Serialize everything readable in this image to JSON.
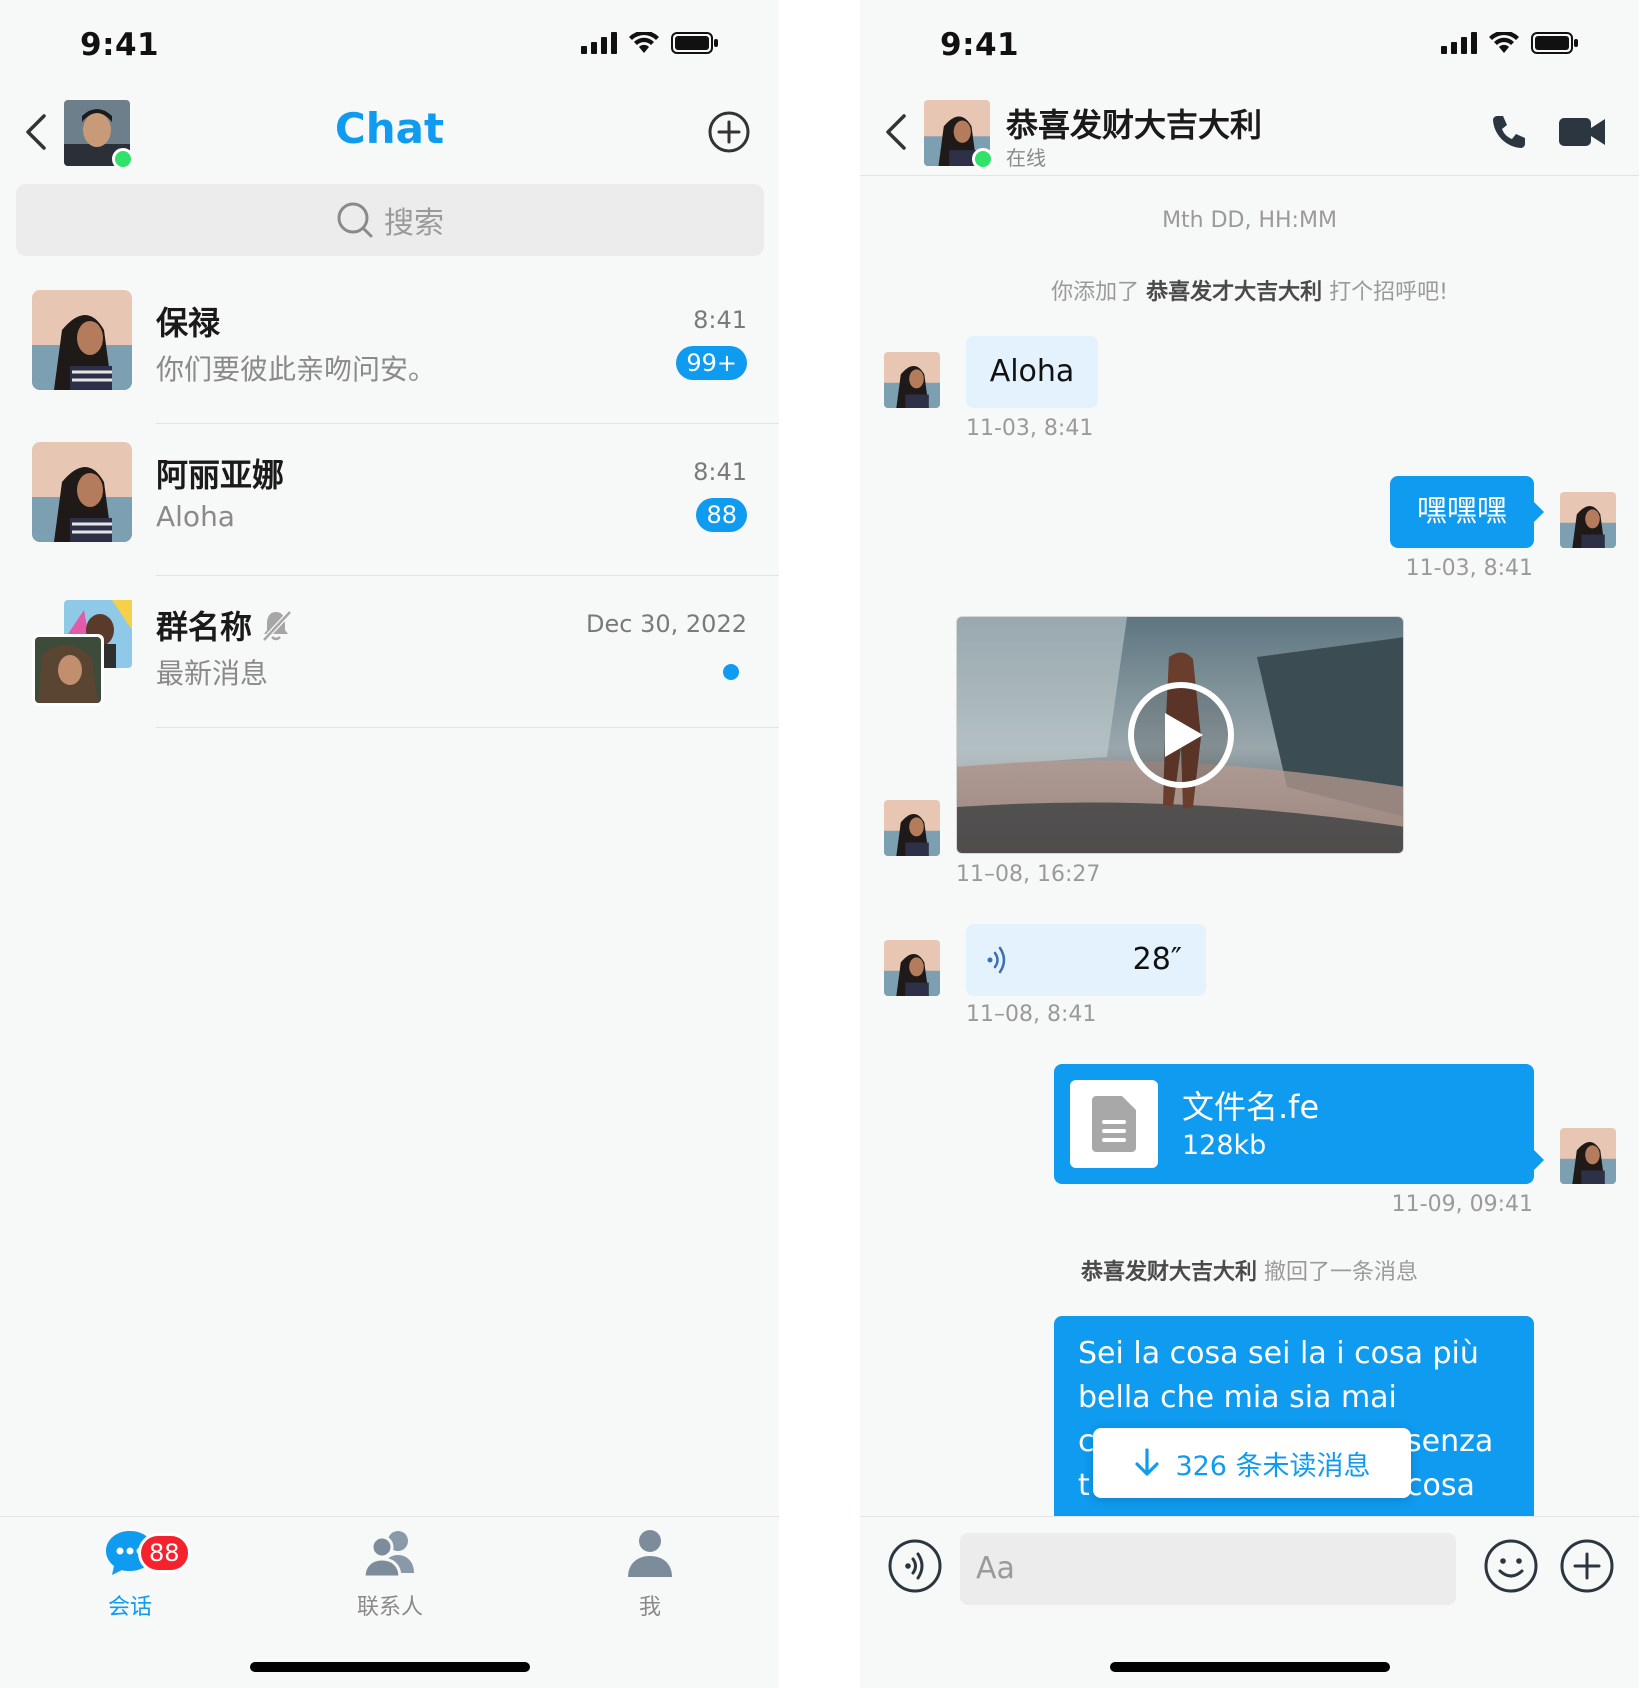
{
  "status_bar": {
    "time": "9:41"
  },
  "chat_list": {
    "title": "Chat",
    "search_placeholder": "搜索",
    "conversations": [
      {
        "name": "保禄",
        "preview": "你们要彼此亲吻问安。",
        "time": "8:41",
        "badge": "99+"
      },
      {
        "name": "阿丽亚娜",
        "preview": "Aloha",
        "time": "8:41",
        "badge": "88"
      },
      {
        "name": "群名称",
        "preview": "最新消息",
        "time": "Dec 30, 2022",
        "muted": true,
        "unread_dot": true
      }
    ],
    "tabs": [
      {
        "label": "会话",
        "icon": "chat-bubble-icon",
        "badge": "88",
        "active": true
      },
      {
        "label": "联系人",
        "icon": "contacts-icon"
      },
      {
        "label": "我",
        "icon": "person-icon"
      }
    ]
  },
  "chat_detail": {
    "peer_name": "恭喜发财大吉大利",
    "peer_status": "在线",
    "timestamp_header": "Mth DD, HH:MM",
    "system_added": {
      "prefix": "你添加了",
      "name": "恭喜发才大吉大利",
      "suffix": "打个招呼吧!"
    },
    "messages": [
      {
        "type": "text",
        "direction": "in",
        "text": "Aloha",
        "time": "11-03, 8:41"
      },
      {
        "type": "text",
        "direction": "out",
        "text": "嘿嘿嘿",
        "time": "11-03, 8:41"
      },
      {
        "type": "video",
        "direction": "in",
        "time": "11–08, 16:27"
      },
      {
        "type": "voice",
        "direction": "in",
        "duration": "28″",
        "time": "11–08, 8:41"
      },
      {
        "type": "file",
        "direction": "out",
        "file_name": "文件名.fe",
        "file_size": "128kb",
        "time": "11-09, 09:41"
      }
    ],
    "system_recall": {
      "name": "恭喜发财大吉大利",
      "text": "撤回了一条消息"
    },
    "long_message": {
      "direction": "out",
      "lines": [
        "Sei la cosa sei la i cosa più",
        "bella che mia sia mai",
        "c",
        "senza",
        "t",
        "cosa"
      ]
    },
    "unread_pill": "326 条未读消息",
    "composer_placeholder": "Aa",
    "colors": {
      "accent": "#0f9bf0",
      "incoming_bubble": "#e3f2fd",
      "online": "#2ee26a",
      "badge_red": "#f5222d"
    }
  }
}
